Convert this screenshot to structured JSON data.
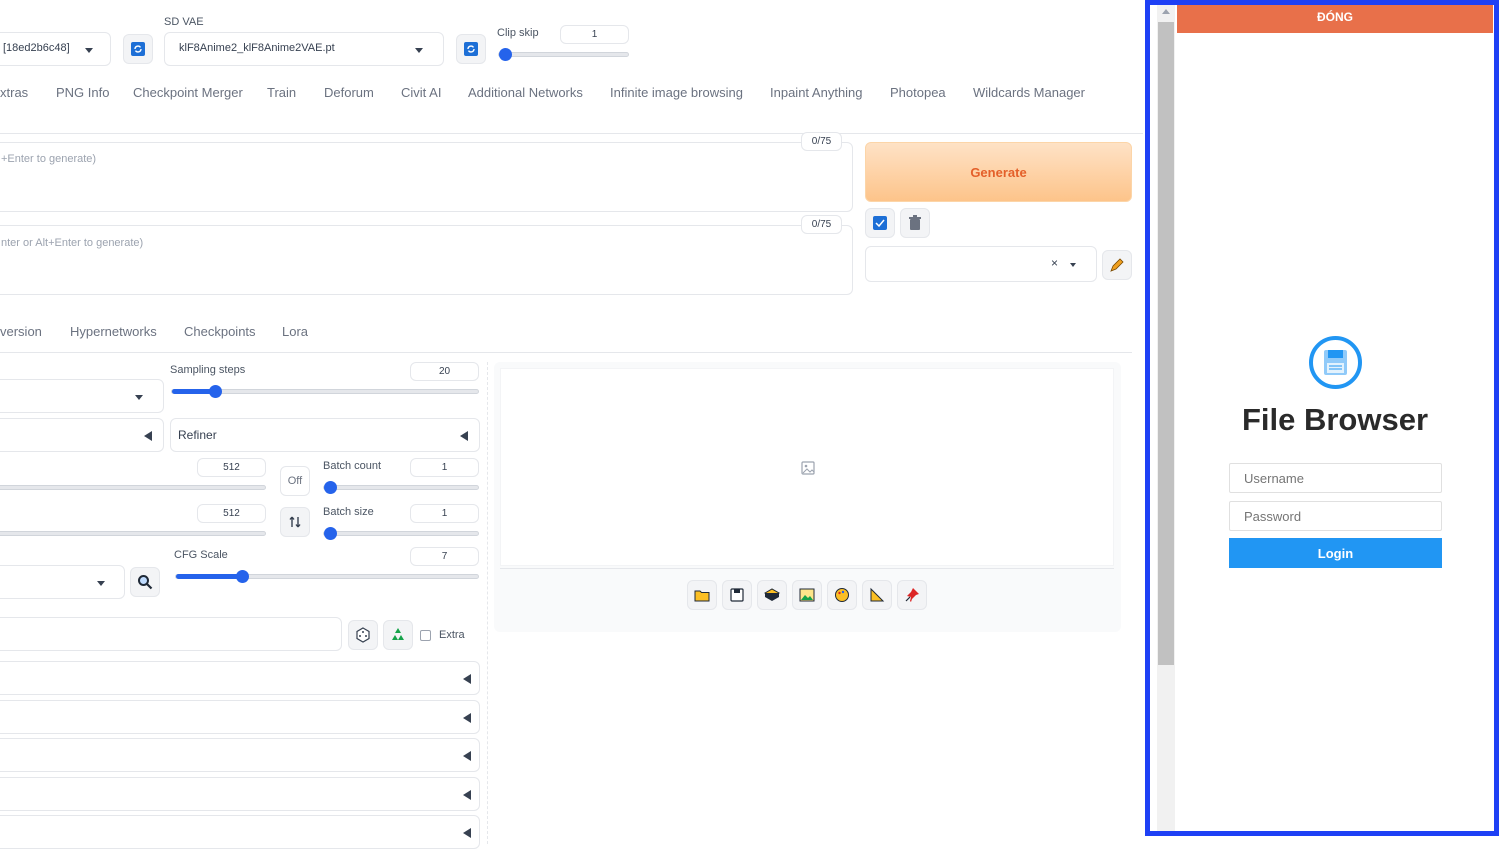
{
  "header": {
    "model_value": "[18ed2b6c48]",
    "vae_label": "SD VAE",
    "vae_value": "klF8Anime2_klF8Anime2VAE.pt",
    "clip_skip_label": "Clip skip",
    "clip_skip_value": "1",
    "clip_skip_fraction": 0.0
  },
  "tabs": [
    "xtras",
    "PNG Info",
    "Checkpoint Merger",
    "Train",
    "Deforum",
    "Civit AI",
    "Additional Networks",
    "Infinite image browsing",
    "Inpaint Anything",
    "Photopea",
    "Wildcards Manager"
  ],
  "prompt": {
    "counter": "0/75",
    "placeholder": "+Enter to generate)"
  },
  "negative_prompt": {
    "counter": "0/75",
    "placeholder": "nter or Alt+Enter to generate)"
  },
  "generate_label": "Generate",
  "subtabs": [
    "version",
    "Hypernetworks",
    "Checkpoints",
    "Lora"
  ],
  "params": {
    "sampling_steps_label": "Sampling steps",
    "sampling_steps_value": "20",
    "refiner_label": "Refiner",
    "width_value": "512",
    "height_value": "512",
    "off_label": "Off",
    "batch_count_label": "Batch count",
    "batch_count_value": "1",
    "batch_size_label": "Batch size",
    "batch_size_value": "1",
    "cfg_label": "CFG Scale",
    "cfg_value": "7",
    "extra_label": "Extra"
  },
  "icons": {
    "refresh": "refresh-icon",
    "trash": "trash-icon",
    "pencil": "pencil-icon",
    "search": "search-icon",
    "dice": "dice-icon",
    "recycle": "recycle-icon",
    "image": "image-icon",
    "folder": "folder-icon",
    "save": "save-icon",
    "zip": "zip-icon",
    "img2img": "img2img-icon",
    "palette": "palette-icon",
    "ruler": "ruler-icon",
    "pin": "pin-icon",
    "floppy": "floppy-icon"
  },
  "overlay": {
    "close_label": "ĐÓNG",
    "title": "File Browser",
    "username_placeholder": "Username",
    "password_placeholder": "Password",
    "login_label": "Login",
    "accent": "#1e40f5",
    "close_bar_color": "#e8704a",
    "login_color": "#2196f3"
  },
  "colors": {
    "slider": "#2563eb",
    "generate_text": "#e4602a"
  }
}
